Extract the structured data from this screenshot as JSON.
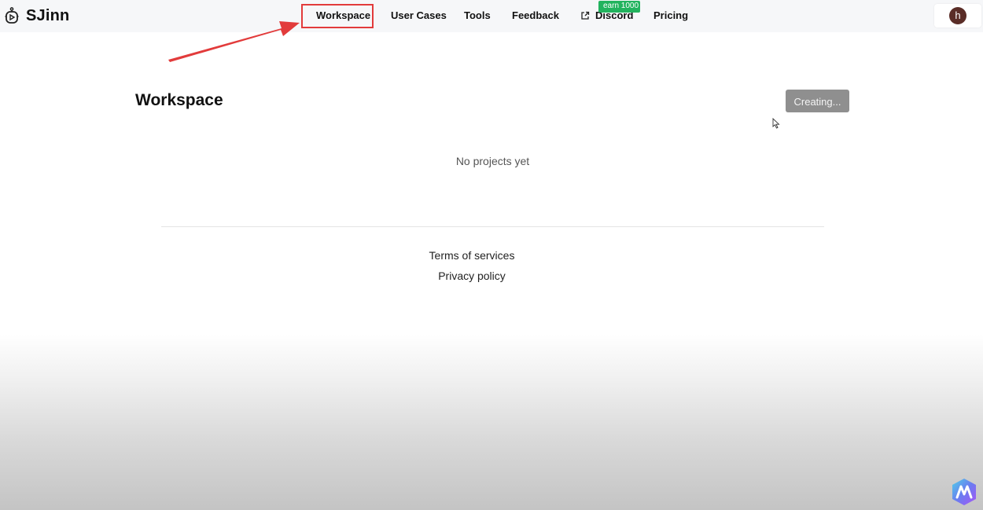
{
  "header": {
    "brand": "SJinn",
    "nav": {
      "workspace": "Workspace",
      "user_cases": "User Cases",
      "tools": "Tools",
      "feedback": "Feedback",
      "discord": "Discord",
      "pricing": "Pricing"
    },
    "discord_badge": "earn 1000",
    "avatar_initial": "h"
  },
  "main": {
    "title": "Workspace",
    "create_button_label": "Creating...",
    "empty_message": "No projects yet"
  },
  "footer": {
    "terms": "Terms of services",
    "privacy": "Privacy policy"
  },
  "colors": {
    "badge_green": "#22b35e",
    "annotation_red": "#e23b3b",
    "avatar_brown": "#5a2d27",
    "button_gray": "#8f8f8f"
  },
  "icons": {
    "logo": "robot-logo-icon",
    "discord_link": "external-link-icon",
    "cursor": "mouse-cursor-icon",
    "assistant": "assistant-app-icon"
  }
}
